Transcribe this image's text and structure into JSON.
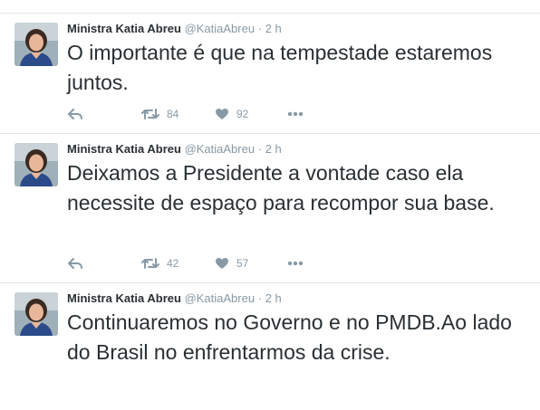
{
  "tweets": [
    {
      "name": "Ministra Katia Abreu",
      "handle": "@KatiaAbreu",
      "sep": "·",
      "time": "2 h",
      "text": "O importante é que na tempestade estaremos juntos.",
      "retweets": "84",
      "likes": "92"
    },
    {
      "name": "Ministra Katia Abreu",
      "handle": "@KatiaAbreu",
      "sep": "·",
      "time": "2 h",
      "text": "Deixamos a Presidente a vontade caso ela necessite de espaço para recompor sua base.",
      "retweets": "42",
      "likes": "57"
    },
    {
      "name": "Ministra Katia Abreu",
      "handle": "@KatiaAbreu",
      "sep": "·",
      "time": "2 h",
      "text": "Continuaremos no Governo e no PMDB.Ao lado do Brasil no enfrentarmos da crise."
    }
  ],
  "icons": {
    "reply": "reply-icon",
    "retweet": "retweet-icon",
    "like": "heart-icon",
    "more": "more-icon"
  },
  "colors": {
    "text": "#292f33",
    "muted": "#8899a6",
    "border": "#e1e8ed"
  }
}
